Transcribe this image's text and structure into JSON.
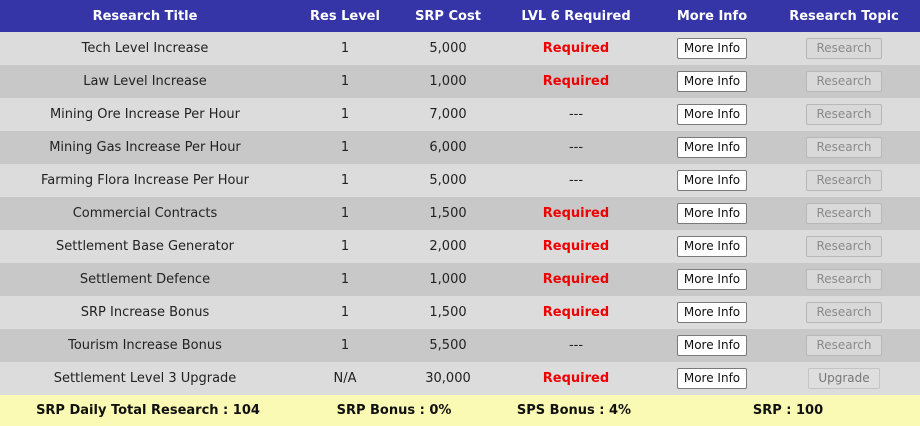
{
  "headers": {
    "title": "Research Title",
    "level": "Res Level",
    "cost": "SRP Cost",
    "lvl6": "LVL 6 Required",
    "info": "More Info",
    "topic": "Research Topic"
  },
  "rows": [
    {
      "title": "Tech Level Increase",
      "level": "1",
      "cost": "5,000",
      "lvl6": "Required",
      "info": "More Info",
      "action": "Research"
    },
    {
      "title": "Law Level Increase",
      "level": "1",
      "cost": "1,000",
      "lvl6": "Required",
      "info": "More Info",
      "action": "Research"
    },
    {
      "title": "Mining Ore Increase Per Hour",
      "level": "1",
      "cost": "7,000",
      "lvl6": "---",
      "info": "More Info",
      "action": "Research"
    },
    {
      "title": "Mining Gas Increase Per Hour",
      "level": "1",
      "cost": "6,000",
      "lvl6": "---",
      "info": "More Info",
      "action": "Research"
    },
    {
      "title": "Farming Flora Increase Per Hour",
      "level": "1",
      "cost": "5,000",
      "lvl6": "---",
      "info": "More Info",
      "action": "Research"
    },
    {
      "title": "Commercial Contracts",
      "level": "1",
      "cost": "1,500",
      "lvl6": "Required",
      "info": "More Info",
      "action": "Research"
    },
    {
      "title": "Settlement Base Generator",
      "level": "1",
      "cost": "2,000",
      "lvl6": "Required",
      "info": "More Info",
      "action": "Research"
    },
    {
      "title": "Settlement Defence",
      "level": "1",
      "cost": "1,000",
      "lvl6": "Required",
      "info": "More Info",
      "action": "Research"
    },
    {
      "title": "SRP Increase Bonus",
      "level": "1",
      "cost": "1,500",
      "lvl6": "Required",
      "info": "More Info",
      "action": "Research"
    },
    {
      "title": "Tourism Increase Bonus",
      "level": "1",
      "cost": "5,500",
      "lvl6": "---",
      "info": "More Info",
      "action": "Research"
    },
    {
      "title": "Settlement Level 3 Upgrade",
      "level": "N/A",
      "cost": "30,000",
      "lvl6": "Required",
      "info": "More Info",
      "action": "Upgrade"
    }
  ],
  "footer": {
    "daily_total": "SRP Daily Total Research : 104",
    "srp_bonus": "SRP Bonus : 0%",
    "sps_bonus": "SPS Bonus : 4%",
    "srp": "SRP : 100"
  },
  "colors": {
    "header_bg": "#3535a8",
    "row_light": "#dcdcdc",
    "row_dark": "#c8c8c8",
    "required": "#ee0000",
    "footer_bg": "#fafab4"
  }
}
